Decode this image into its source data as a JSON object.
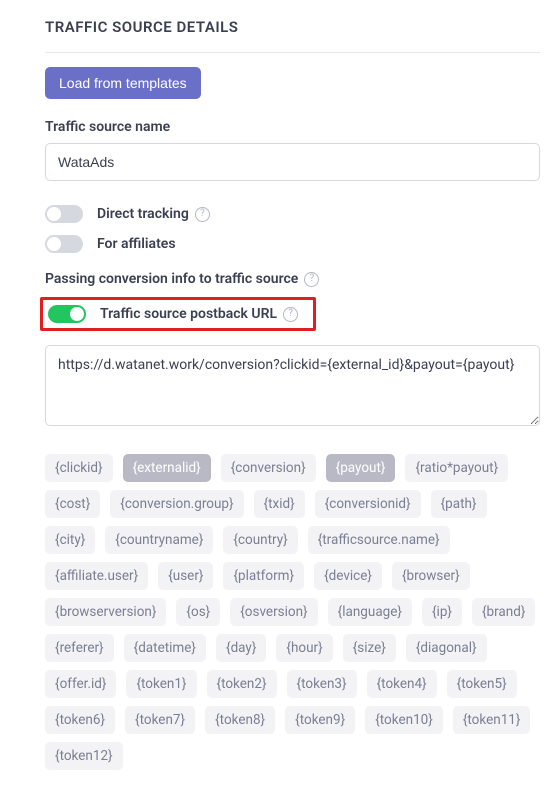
{
  "section_title": "TRAFFIC SOURCE DETAILS",
  "load_templates_label": "Load from templates",
  "name_field": {
    "label": "Traffic source name",
    "value": "WataAds"
  },
  "toggles": {
    "direct_tracking": {
      "label": "Direct tracking",
      "on": false,
      "help": true
    },
    "for_affiliates": {
      "label": "For affiliates",
      "on": false,
      "help": false
    }
  },
  "passing_info_label": "Passing conversion info to traffic source",
  "postback": {
    "toggle_label": "Traffic source postback URL",
    "toggle_on": true,
    "url": "https://d.watanet.work/conversion?clickid={external_id}&payout={payout}"
  },
  "tokens": [
    {
      "text": "{clickid}",
      "active": false
    },
    {
      "text": "{externalid}",
      "active": true
    },
    {
      "text": "{conversion}",
      "active": false
    },
    {
      "text": "{payout}",
      "active": true
    },
    {
      "text": "{ratio*payout}",
      "active": false
    },
    {
      "text": "{cost}",
      "active": false
    },
    {
      "text": "{conversion.group}",
      "active": false
    },
    {
      "text": "{txid}",
      "active": false
    },
    {
      "text": "{conversionid}",
      "active": false
    },
    {
      "text": "{path}",
      "active": false
    },
    {
      "text": "{city}",
      "active": false
    },
    {
      "text": "{countryname}",
      "active": false
    },
    {
      "text": "{country}",
      "active": false
    },
    {
      "text": "{trafficsource.name}",
      "active": false
    },
    {
      "text": "{affiliate.user}",
      "active": false
    },
    {
      "text": "{user}",
      "active": false
    },
    {
      "text": "{platform}",
      "active": false
    },
    {
      "text": "{device}",
      "active": false
    },
    {
      "text": "{browser}",
      "active": false
    },
    {
      "text": "{browserversion}",
      "active": false
    },
    {
      "text": "{os}",
      "active": false
    },
    {
      "text": "{osversion}",
      "active": false
    },
    {
      "text": "{language}",
      "active": false
    },
    {
      "text": "{ip}",
      "active": false
    },
    {
      "text": "{brand}",
      "active": false
    },
    {
      "text": "{referer}",
      "active": false
    },
    {
      "text": "{datetime}",
      "active": false
    },
    {
      "text": "{day}",
      "active": false
    },
    {
      "text": "{hour}",
      "active": false
    },
    {
      "text": "{size}",
      "active": false
    },
    {
      "text": "{diagonal}",
      "active": false
    },
    {
      "text": "{offer.id}",
      "active": false
    },
    {
      "text": "{token1}",
      "active": false
    },
    {
      "text": "{token2}",
      "active": false
    },
    {
      "text": "{token3}",
      "active": false
    },
    {
      "text": "{token4}",
      "active": false
    },
    {
      "text": "{token5}",
      "active": false
    },
    {
      "text": "{token6}",
      "active": false
    },
    {
      "text": "{token7}",
      "active": false
    },
    {
      "text": "{token8}",
      "active": false
    },
    {
      "text": "{token9}",
      "active": false
    },
    {
      "text": "{token10}",
      "active": false
    },
    {
      "text": "{token11}",
      "active": false
    },
    {
      "text": "{token12}",
      "active": false
    }
  ]
}
